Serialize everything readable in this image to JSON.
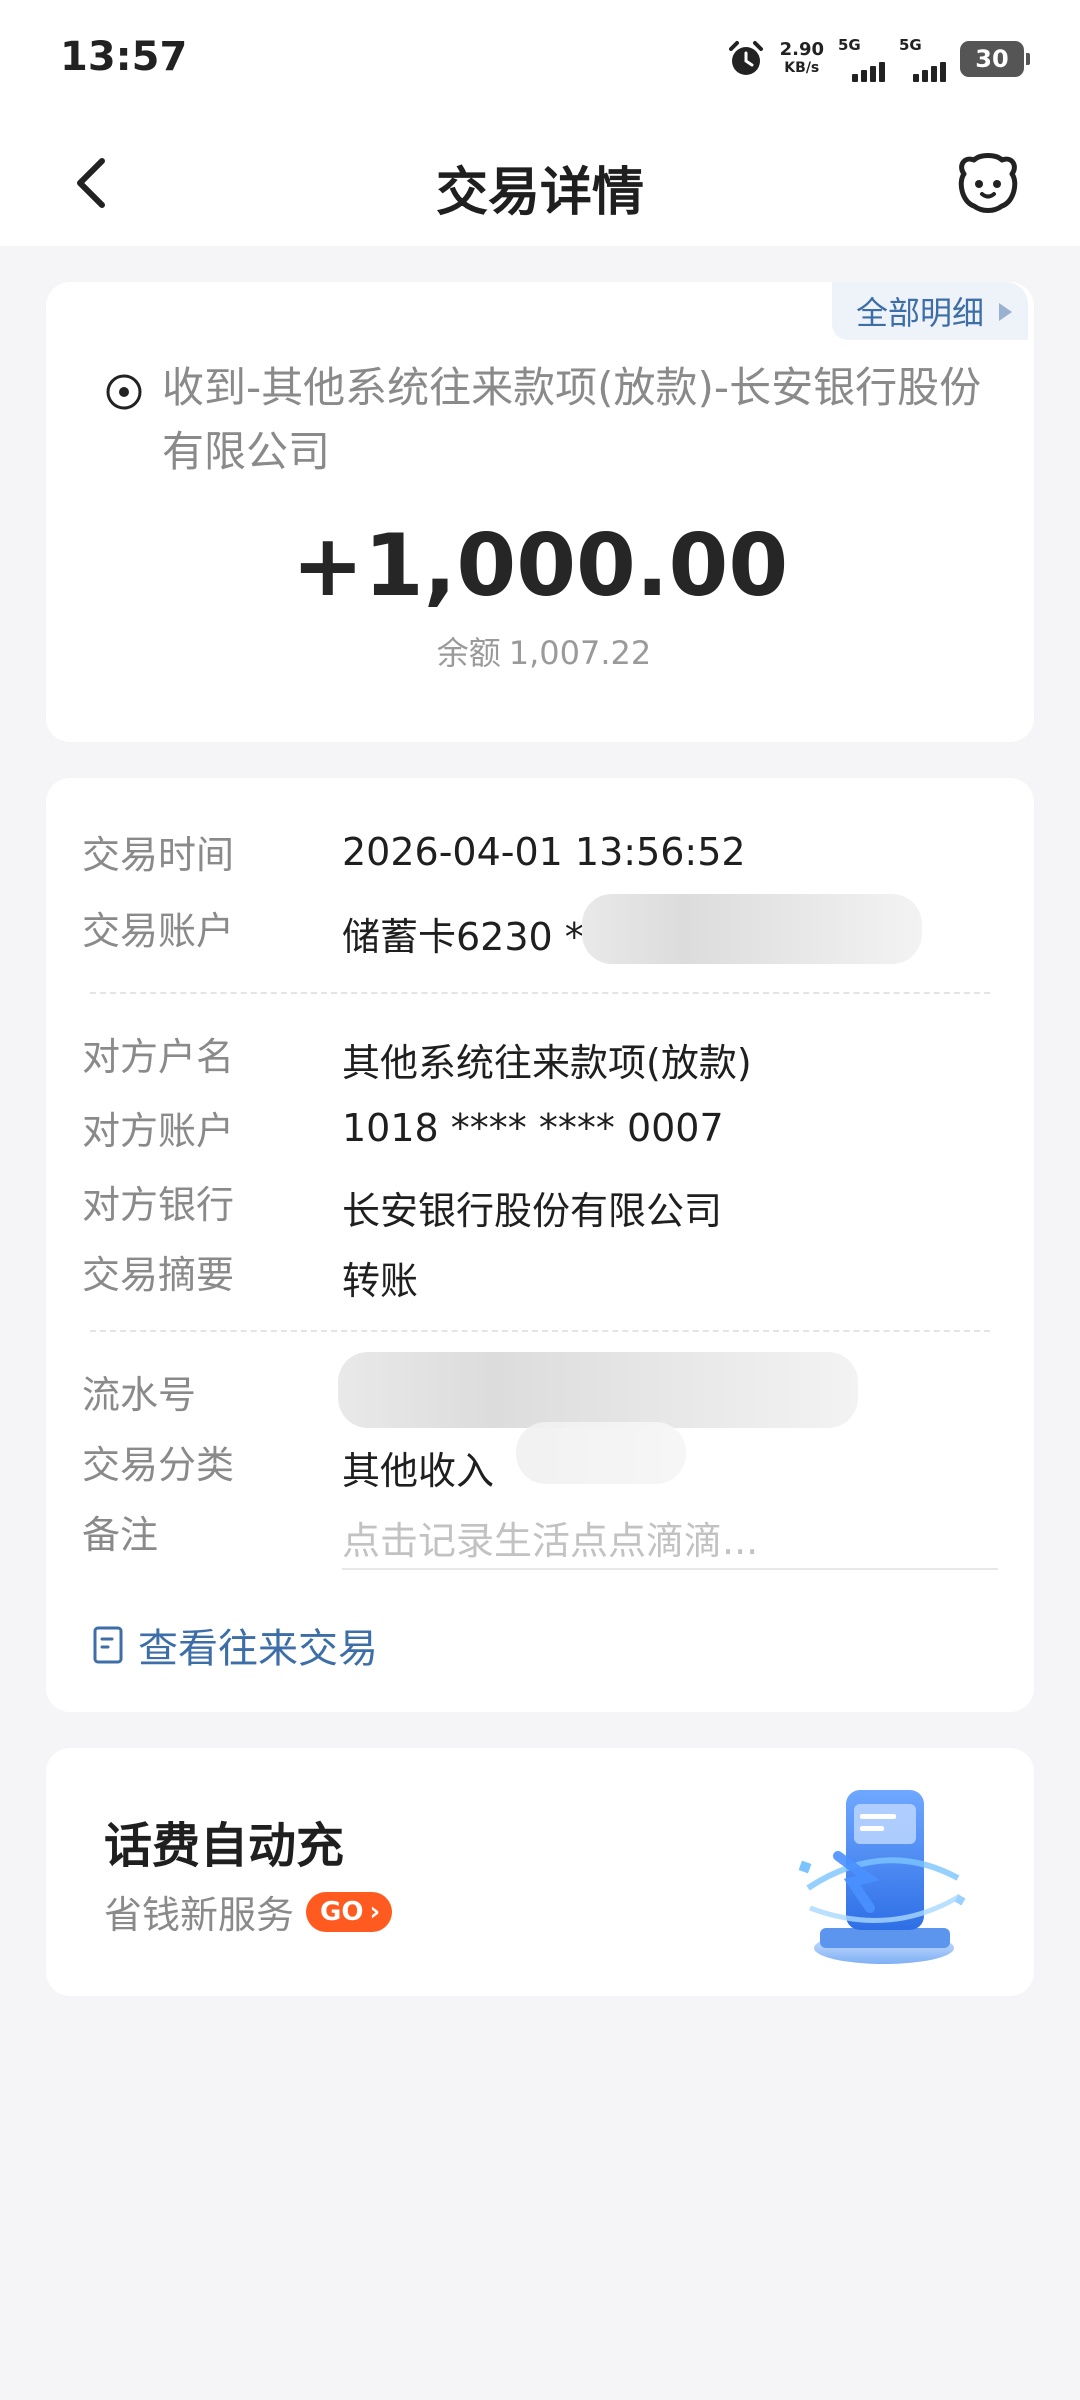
{
  "status_bar": {
    "time": "13:57",
    "net_speed_value": "2.90",
    "net_speed_unit": "KB/s",
    "sim1": "5G",
    "sim2": "5G",
    "battery": "30"
  },
  "nav": {
    "title": "交易详情",
    "back_icon": "chevron-left-icon",
    "assistant_icon": "robot-face-icon"
  },
  "summary": {
    "all_details_link": "全部明细",
    "description": "收到-其他系统往来款项(放款)-长安银行股份有限公司",
    "amount": "+1,000.00",
    "balance_label": "余额",
    "balance_value": "1,007.22"
  },
  "details": {
    "rows": [
      {
        "label": "交易时间",
        "value": "2026-04-01 13:56:52"
      },
      {
        "label": "交易账户",
        "value": "储蓄卡6230 *"
      },
      {
        "label": "对方户名",
        "value": "其他系统往来款项(放款)"
      },
      {
        "label": "对方账户",
        "value": "1018 **** **** 0007"
      },
      {
        "label": "对方银行",
        "value": "长安银行股份有限公司"
      },
      {
        "label": "交易摘要",
        "value": "转账"
      },
      {
        "label": "流水号",
        "value": ""
      },
      {
        "label": "交易分类",
        "value": "其他收入"
      },
      {
        "label": "备注",
        "placeholder": "点击记录生活点点滴滴..."
      }
    ],
    "history_link": "查看往来交易"
  },
  "promo": {
    "title": "话费自动充",
    "subtitle": "省钱新服务",
    "go_label": "GO"
  },
  "colors": {
    "accent_blue": "#3d6ea8",
    "go_orange": "#ff5a1f",
    "page_bg": "#f5f5f7"
  }
}
